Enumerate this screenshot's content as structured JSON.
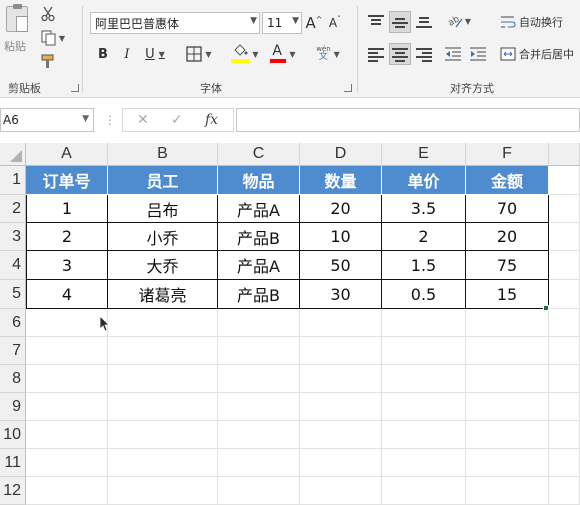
{
  "ribbon": {
    "clipboard": {
      "label": "剪贴板",
      "paste_label": "粘贴"
    },
    "font": {
      "label": "字体",
      "font_name": "阿里巴巴普惠体",
      "font_size": "11",
      "bold": "B",
      "italic": "I",
      "underline": "U",
      "grow": "A",
      "shrink": "A",
      "font_color_glyph": "A",
      "phonetic_top": "wén",
      "phonetic_bottom": "文"
    },
    "alignment": {
      "label": "对齐方式",
      "wrap_text": "自动换行",
      "merge_center": "合并后居中"
    }
  },
  "formula_bar": {
    "name_box": "A6",
    "cancel": "✕",
    "enter": "✓",
    "fx": "fx",
    "formula": ""
  },
  "sheet": {
    "columns": [
      "A",
      "B",
      "C",
      "D",
      "E",
      "F"
    ],
    "rows": [
      "1",
      "2",
      "3",
      "4",
      "5",
      "6",
      "7",
      "8",
      "9",
      "10",
      "11",
      "12"
    ],
    "header": [
      "订单号",
      "员工",
      "物品",
      "数量",
      "单价",
      "金额"
    ],
    "data": [
      [
        "1",
        "吕布",
        "产品A",
        "20",
        "3.5",
        "70"
      ],
      [
        "2",
        "小乔",
        "产品B",
        "10",
        "2",
        "20"
      ],
      [
        "3",
        "大乔",
        "产品A",
        "50",
        "1.5",
        "75"
      ],
      [
        "4",
        "诸葛亮",
        "产品B",
        "30",
        "0.5",
        "15"
      ]
    ]
  },
  "colors": {
    "header_fill": "#4f8ccf",
    "header_text": "#ffffff",
    "font_color_bar": "#ff0000",
    "fill_color_bar": "#ffff00"
  }
}
